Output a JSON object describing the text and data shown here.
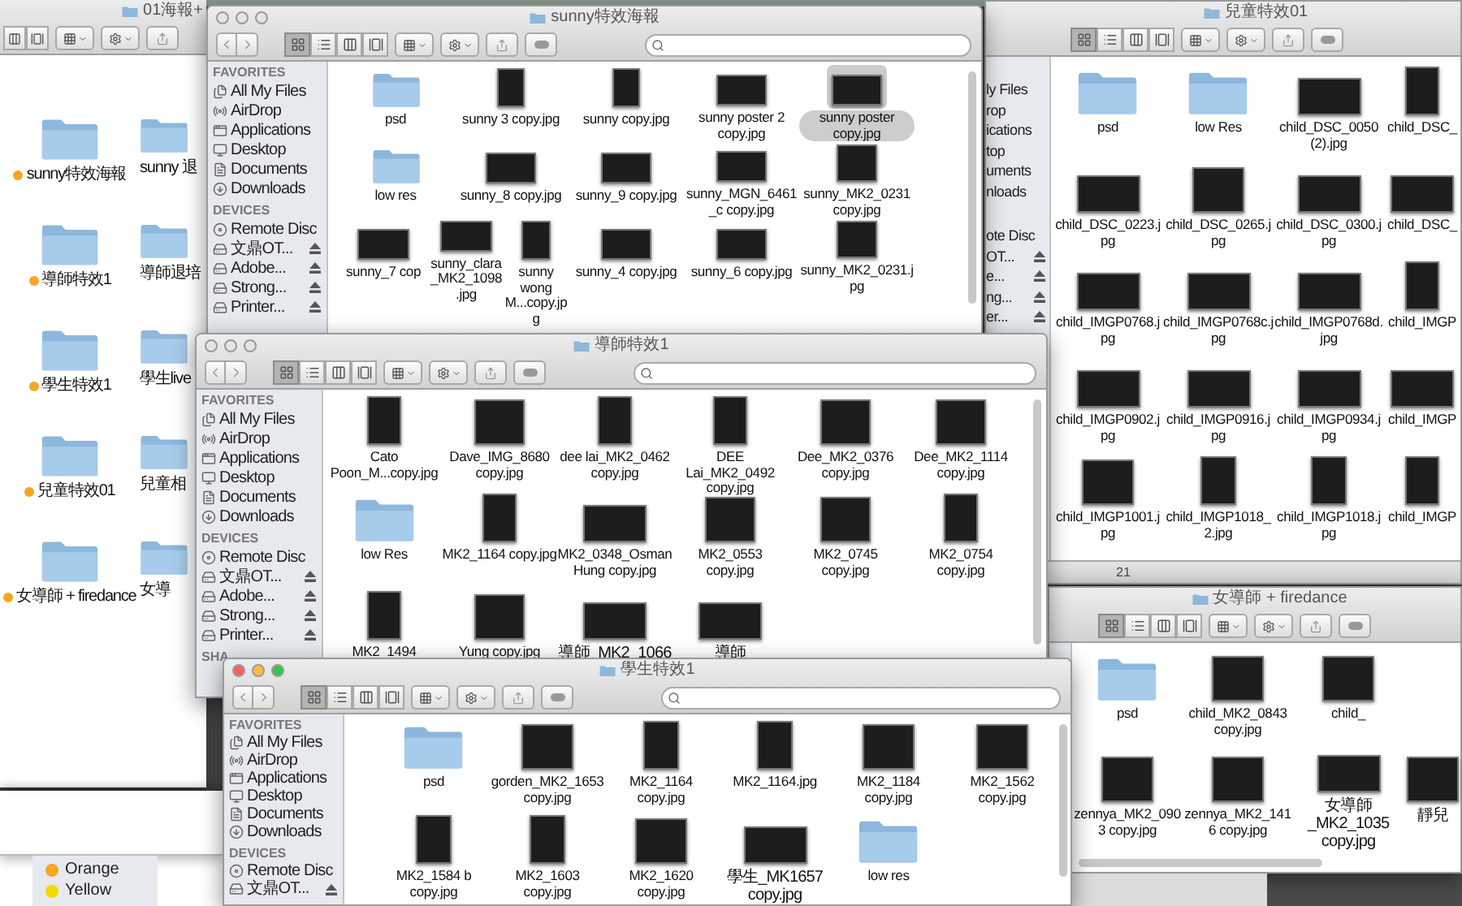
{
  "desktop_window": {
    "title": "01海報+",
    "rows": [
      [
        {
          "name": "sunny特效海報",
          "color": "#f5a623",
          "selected": false
        },
        {
          "name": "sunny 退",
          "selected": false
        }
      ],
      [
        {
          "name": "導師特效1",
          "color": "#f5a623",
          "selected": false
        },
        {
          "name": "導師退培",
          "selected": false
        }
      ],
      [
        {
          "name": "學生特效1",
          "color": "#f5a623",
          "selected": false
        },
        {
          "name": "學生live",
          "selected": false
        }
      ],
      [
        {
          "name": "兒童特效01",
          "color": "#f5a623",
          "selected": false
        },
        {
          "name": "兒童相",
          "selected": false
        }
      ],
      [
        {
          "name": "女導師 + firedance",
          "color": "#f5a623",
          "selected": false
        },
        {
          "name": "女導",
          "selected": false
        }
      ]
    ]
  },
  "tags_window": {
    "tags": [
      {
        "label": "Orange",
        "color": "#f5a623"
      },
      {
        "label": "Yellow",
        "color": "#f5d800"
      }
    ]
  },
  "children_window": {
    "title": "兒童特效01",
    "icon_view": true,
    "sidebar_fragments": [
      [
        {
          "label": "ly Files",
          "eject": false
        },
        {
          "label": "rop",
          "eject": false
        },
        {
          "label": "ications",
          "eject": false
        },
        {
          "label": "top",
          "eject": false
        },
        {
          "label": "uments",
          "eject": false
        },
        {
          "label": "nloads",
          "eject": false
        }
      ],
      [
        {
          "label": "ote Disc",
          "eject": false
        },
        {
          "label": "OT...",
          "eject": true
        },
        {
          "label": "e...",
          "eject": true
        },
        {
          "label": "ng...",
          "eject": true
        },
        {
          "label": "er...",
          "eject": true
        }
      ]
    ],
    "rows": [
      [
        {
          "name": "psd",
          "kind": "folder",
          "selected": false
        },
        {
          "name": "low Res",
          "kind": "folder",
          "selected": false
        },
        {
          "name": "child_DSC_0050 (2).jpg",
          "kind": "landscape",
          "selected": false
        },
        {
          "name": "child_DSC_",
          "kind": "portrait",
          "selected": false
        }
      ],
      [
        {
          "name": "child_DSC_0223.jpg",
          "kind": "landscape",
          "selected": false
        },
        {
          "name": "child_DSC_0265.jpg",
          "kind": "square",
          "selected": false
        },
        {
          "name": "child_DSC_0300.jpg",
          "kind": "landscape",
          "selected": false
        },
        {
          "name": "child_DSC_",
          "kind": "landscape",
          "selected": false
        }
      ],
      [
        {
          "name": "child_IMGP0768.jpg",
          "kind": "landscape",
          "selected": false
        },
        {
          "name": "child_IMGP0768c.jpg",
          "kind": "landscape",
          "selected": false
        },
        {
          "name": "child_IMGP0768d.jpg",
          "kind": "landscape",
          "selected": false
        },
        {
          "name": "child_IMGP",
          "kind": "portrait",
          "selected": false
        }
      ],
      [
        {
          "name": "child_IMGP0902.jpg",
          "kind": "landscape",
          "selected": false
        },
        {
          "name": "child_IMGP0916.jpg",
          "kind": "landscape",
          "selected": false
        },
        {
          "name": "child_IMGP0934.jpg",
          "kind": "landscape",
          "selected": false
        },
        {
          "name": "child_IMGP",
          "kind": "landscape",
          "selected": false
        }
      ],
      [
        {
          "name": "child_IMGP1001.jpg",
          "kind": "square",
          "selected": false
        },
        {
          "name": "child_IMGP1018_2.jpg",
          "kind": "portrait",
          "selected": false
        },
        {
          "name": "child_IMGP1018.jpg",
          "kind": "portrait",
          "selected": false
        },
        {
          "name": "child_IMGP",
          "kind": "portrait",
          "selected": false
        }
      ]
    ],
    "status": "21"
  },
  "sunny_window": {
    "title": "sunny特效海報",
    "active": false,
    "icon_view": true,
    "sidebar": [
      {
        "heading": "FAVORITES",
        "items": [
          {
            "label": "All My Files",
            "kind": "files"
          },
          {
            "label": "AirDrop",
            "kind": "airdrop"
          },
          {
            "label": "Applications",
            "kind": "applications"
          },
          {
            "label": "Desktop",
            "kind": "desktop"
          },
          {
            "label": "Documents",
            "kind": "documents"
          },
          {
            "label": "Downloads",
            "kind": "downloads"
          }
        ]
      },
      {
        "heading": "DEVICES",
        "items": [
          {
            "label": "Remote Disc",
            "kind": "disc",
            "eject": false
          },
          {
            "label": "文鼎OT...",
            "kind": "drive",
            "eject": true
          },
          {
            "label": "Adobe...",
            "kind": "drive",
            "eject": true
          },
          {
            "label": "Strong...",
            "kind": "drive",
            "eject": true
          },
          {
            "label": "Printer...",
            "kind": "drive",
            "eject": true
          }
        ]
      }
    ],
    "rows": [
      [
        {
          "name": "psd",
          "kind": "folder",
          "selected": false
        },
        {
          "name": "sunny 3 copy.jpg",
          "kind": "portrait",
          "selected": false
        },
        {
          "name": "sunny copy.jpg",
          "kind": "portrait",
          "selected": false
        },
        {
          "name": "sunny poster 2 copy.jpg",
          "kind": "landscape",
          "selected": false
        },
        {
          "name": "sunny poster copy.jpg",
          "kind": "landscape",
          "selected": true
        }
      ],
      [
        {
          "name": "low res",
          "kind": "folder",
          "selected": false
        },
        {
          "name": "sunny_8 copy.jpg",
          "kind": "landscape",
          "selected": false
        },
        {
          "name": "sunny_9 copy.jpg",
          "kind": "landscape",
          "selected": false
        },
        {
          "name": "sunny_MGN_6461_c copy.jpg",
          "kind": "landscape",
          "selected": false
        },
        {
          "name": "sunny_MK2_0231 copy.jpg",
          "kind": "square",
          "selected": false
        }
      ],
      [
        {
          "name": "sunny_7 cop",
          "kind": "landscape",
          "selected": false
        },
        {
          "overlap": [
            {
              "name": "sunny_clara_MK2_1098.jpg",
              "kind": "landscape",
              "selected": false
            },
            {
              "name": "sunny wong M...copy.jpg",
              "kind": "portrait",
              "selected": false
            }
          ]
        },
        {
          "name": "sunny_4 copy.jpg",
          "kind": "landscape",
          "selected": false
        },
        {
          "name": "sunny_6 copy.jpg",
          "kind": "landscape",
          "selected": false
        },
        {
          "name": "sunny_MK2_0231.jpg",
          "kind": "square",
          "selected": false
        }
      ]
    ]
  },
  "female_window": {
    "title": "女導師 + firedance",
    "icon_view": true,
    "rows": [
      [
        {
          "name": "psd",
          "kind": "folder",
          "selected": false
        },
        {
          "name": "child_MK2_0843 copy.jpg",
          "kind": "square",
          "selected": false
        },
        {
          "name": "child_",
          "kind": "square",
          "selected": false
        }
      ],
      [
        {
          "name": "zennya_MK2_0903 copy.jpg",
          "kind": "square",
          "selected": false
        },
        {
          "name": "zennya_MK2_1416 copy.jpg",
          "kind": "square",
          "selected": false
        },
        {
          "name": "女導師_MK2_1035 copy.jpg",
          "kind": "landscape",
          "selected": false
        },
        {
          "name": "靜兒",
          "kind": "square",
          "selected": false
        }
      ]
    ]
  },
  "teacher_window": {
    "title": "導師特效1",
    "active": false,
    "icon_view": true,
    "sidebar": [
      {
        "heading": "FAVORITES",
        "items": [
          {
            "label": "All My Files",
            "kind": "files"
          },
          {
            "label": "AirDrop",
            "kind": "airdrop"
          },
          {
            "label": "Applications",
            "kind": "applications"
          },
          {
            "label": "Desktop",
            "kind": "desktop"
          },
          {
            "label": "Documents",
            "kind": "documents"
          },
          {
            "label": "Downloads",
            "kind": "downloads"
          }
        ]
      },
      {
        "heading": "DEVICES",
        "items": [
          {
            "label": "Remote Disc",
            "kind": "disc",
            "eject": false
          },
          {
            "label": "文鼎OT...",
            "kind": "drive",
            "eject": true
          },
          {
            "label": "Adobe...",
            "kind": "drive",
            "eject": true
          },
          {
            "label": "Strong...",
            "kind": "drive",
            "eject": true
          },
          {
            "label": "Printer...",
            "kind": "drive",
            "eject": true
          }
        ]
      },
      {
        "heading": "SHA"
      }
    ],
    "rows": [
      [
        {
          "name": "Cato Poon_M...copy.jpg",
          "kind": "portrait",
          "selected": false
        },
        {
          "name": "Dave_IMG_8680 copy.jpg",
          "kind": "square",
          "selected": false
        },
        {
          "name": "dee lai_MK2_0462 copy.jpg",
          "kind": "portrait",
          "selected": false
        },
        {
          "name": "DEE Lai_MK2_0492 copy.jpg",
          "kind": "portrait",
          "selected": false
        },
        {
          "name": "Dee_MK2_0376 copy.jpg",
          "kind": "square",
          "selected": false
        },
        {
          "name": "Dee_MK2_1114 copy.jpg",
          "kind": "square",
          "selected": false
        }
      ],
      [
        {
          "name": "low Res",
          "kind": "folder",
          "selected": false
        },
        {
          "name": "MK2_1164 copy.jpg",
          "kind": "portrait",
          "selected": false
        },
        {
          "name": "MK2_0348_Osman Hung copy.jpg",
          "kind": "landscape",
          "selected": false
        },
        {
          "name": "MK2_0553 copy.jpg",
          "kind": "square",
          "selected": false
        },
        {
          "name": "MK2_0745 copy.jpg",
          "kind": "square",
          "selected": false
        },
        {
          "name": "MK2_0754 copy.jpg",
          "kind": "portrait",
          "selected": false
        }
      ],
      [
        {
          "name": "MK2_1494",
          "kind": "portrait",
          "selected": false
        },
        {
          "name": "Yung copy.jpg",
          "kind": "square",
          "selected": false
        },
        {
          "name": "導師_MK2_1066",
          "kind": "landscape",
          "selected": false
        },
        {
          "name": "導師",
          "kind": "landscape",
          "selected": false
        }
      ]
    ]
  },
  "student_window": {
    "title": "學生特效1",
    "active": true,
    "icon_view": true,
    "sidebar": [
      {
        "heading": "FAVORITES",
        "items": [
          {
            "label": "All My Files",
            "kind": "files"
          },
          {
            "label": "AirDrop",
            "kind": "airdrop"
          },
          {
            "label": "Applications",
            "kind": "applications"
          },
          {
            "label": "Desktop",
            "kind": "desktop"
          },
          {
            "label": "Documents",
            "kind": "documents"
          },
          {
            "label": "Downloads",
            "kind": "downloads"
          }
        ]
      },
      {
        "heading": "DEVICES",
        "items": [
          {
            "label": "Remote Disc",
            "kind": "disc",
            "eject": false
          },
          {
            "label": "文鼎OT...",
            "kind": "drive",
            "eject": true
          }
        ]
      }
    ],
    "rows": [
      [
        {
          "name": "psd",
          "kind": "folder",
          "selected": false
        },
        {
          "name": "gorden_MK2_1653 copy.jpg",
          "kind": "square",
          "selected": false
        },
        {
          "name": "MK2_1164 copy.jpg",
          "kind": "portrait",
          "selected": false
        },
        {
          "name": "MK2_1164.jpg",
          "kind": "portrait",
          "selected": false
        },
        {
          "name": "MK2_1184 copy.jpg",
          "kind": "square",
          "selected": false
        },
        {
          "name": "MK2_1562 copy.jpg",
          "kind": "square",
          "selected": false
        }
      ],
      [
        {
          "name": "MK2_1584 b copy.jpg",
          "kind": "portrait",
          "selected": false
        },
        {
          "name": "MK2_1603 copy.jpg",
          "kind": "portrait",
          "selected": false
        },
        {
          "name": "MK2_1620 copy.jpg",
          "kind": "square",
          "selected": false
        },
        {
          "name": "學生_MK1657 copy.jpg",
          "kind": "landscape",
          "selected": false
        },
        {
          "name": "low res",
          "kind": "folder",
          "selected": false
        }
      ]
    ]
  }
}
